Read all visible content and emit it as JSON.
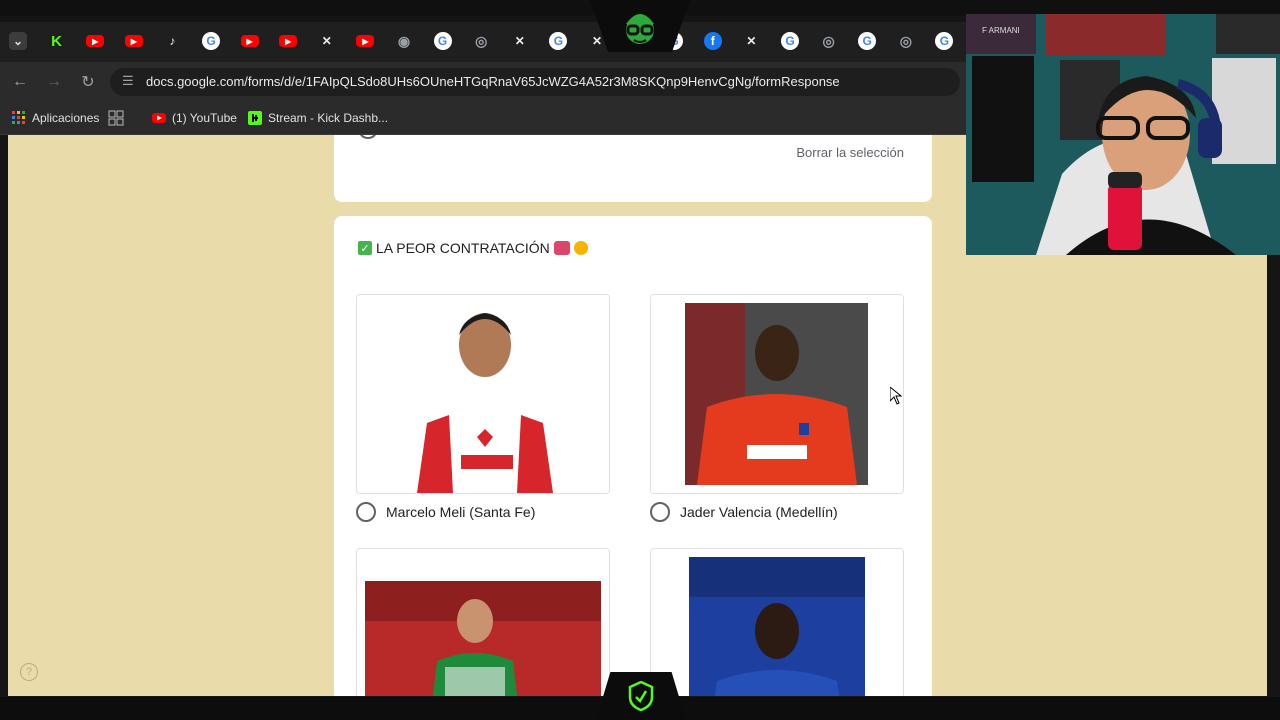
{
  "browser": {
    "tabs": [
      {
        "icon": "chevron-down-icon",
        "color": "#555"
      },
      {
        "icon": "kick-icon",
        "color": "#53fc18"
      },
      {
        "icon": "youtube-icon",
        "color": "#ff0000"
      },
      {
        "icon": "youtube-icon",
        "color": "#ff0000"
      },
      {
        "icon": "tiktok-icon",
        "color": "#000000"
      },
      {
        "icon": "google-icon",
        "color": "#4285f4"
      },
      {
        "icon": "youtube-icon",
        "color": "#ff0000"
      },
      {
        "icon": "youtube-icon",
        "color": "#ff0000"
      },
      {
        "icon": "x-icon",
        "color": "#000000"
      },
      {
        "icon": "youtube-icon",
        "color": "#ff0000"
      },
      {
        "icon": "chrome-icon",
        "color": "#888"
      },
      {
        "icon": "google-icon",
        "color": "#4285f4"
      },
      {
        "icon": "globe-icon",
        "color": "#888"
      },
      {
        "icon": "x-icon",
        "color": "#000000"
      },
      {
        "icon": "google-icon",
        "color": "#4285f4"
      },
      {
        "icon": "x-icon",
        "color": "#000000"
      },
      {
        "icon": "x-icon",
        "color": "#000000"
      },
      {
        "icon": "google-icon",
        "color": "#4285f4"
      },
      {
        "icon": "facebook-icon",
        "color": "#1877f2"
      },
      {
        "icon": "x-icon",
        "color": "#000000"
      },
      {
        "icon": "google-icon",
        "color": "#4285f4"
      },
      {
        "icon": "globe-icon",
        "color": "#888"
      },
      {
        "icon": "google-icon",
        "color": "#4285f4"
      },
      {
        "icon": "globe-icon",
        "color": "#888"
      },
      {
        "icon": "google-icon",
        "color": "#4285f4"
      }
    ],
    "url": "docs.google.com/forms/d/e/1FAIpQLSdo8UHs6OUneHTGqRnaV65JcWZG4A52r3M8SKQnp9HenvCgNg/formResponse",
    "bookmarks": {
      "apps": "Aplicaciones",
      "youtube": "(1) YouTube",
      "stream": "Stream - Kick Dashb..."
    }
  },
  "form": {
    "prev_clear": "Borrar la selección",
    "question": "LA PEOR CONTRATACIÓN",
    "options": [
      {
        "label": "Marcelo Meli (Santa Fe)",
        "bg": "#ffffff",
        "shirt": "#d6262b"
      },
      {
        "label": "Jader Valencia (Medellín)",
        "bg": "#4a4a4a",
        "shirt": "#e43b1e"
      },
      {
        "label": "",
        "bg": "#b82a2a",
        "shirt": "#1f8a3c"
      },
      {
        "label": "",
        "bg": "#1d3fa0",
        "shirt": "#2450b8"
      }
    ]
  },
  "webcam": {
    "label": "F ARMANI"
  },
  "colors": {
    "page_bg": "#e9dcaa",
    "kick_green": "#53fc18"
  }
}
